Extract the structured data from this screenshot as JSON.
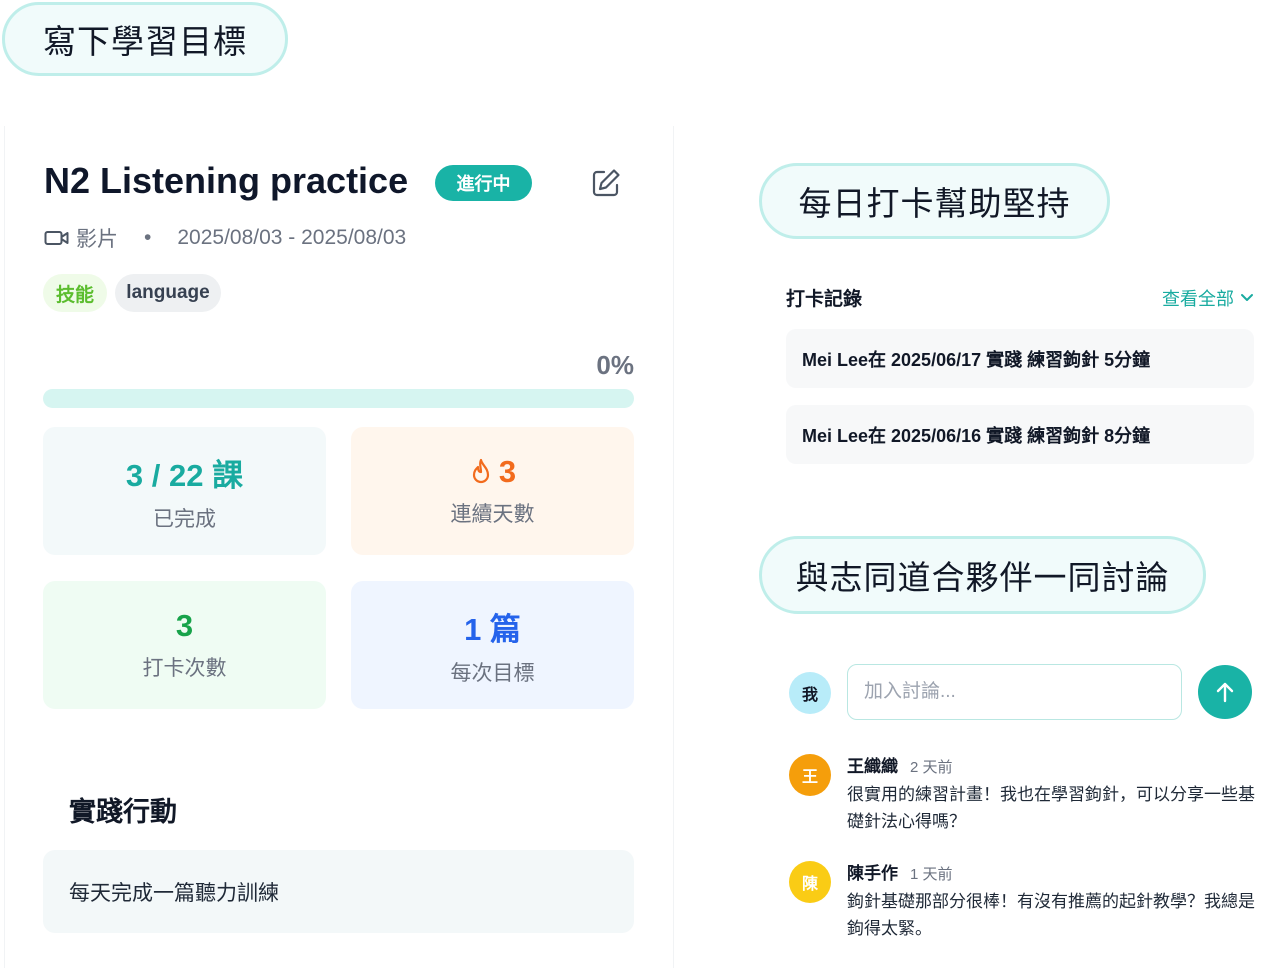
{
  "headers": {
    "pill1": "寫下學習目標",
    "pill2": "每日打卡幫助堅持",
    "pill3": "與志同道合夥伴一同討論"
  },
  "goal": {
    "title": "N2 Listening practice",
    "status": "進行中",
    "type_label": "影片",
    "separator": "•",
    "date_range": "2025/08/03 - 2025/08/03",
    "tags": [
      "技能",
      "language"
    ],
    "progress_label": "0%",
    "progress_fraction": 0.0
  },
  "stats": [
    {
      "value": "3 / 22 課",
      "label": "已完成"
    },
    {
      "value": "3",
      "label": "連續天數",
      "icon": "flame-icon"
    },
    {
      "value": "3",
      "label": "打卡次數"
    },
    {
      "value": "1 篇",
      "label": "每次目標"
    }
  ],
  "actions": {
    "title": "實踐行動",
    "items": [
      "每天完成一篇聽力訓練"
    ]
  },
  "checkins": {
    "title": "打卡記錄",
    "view_all": "查看全部",
    "items": [
      "Mei Lee在 2025/06/17 實踐 練習鉤針 5分鐘",
      "Mei Lee在 2025/06/16 實踐 練習鉤針 8分鐘"
    ]
  },
  "discussion": {
    "me_avatar": "我",
    "input_placeholder": "加入討論...",
    "comments": [
      {
        "avatar": "王",
        "name": "王織織",
        "time": "2 天前",
        "text": "很實用的練習計畫！我也在學習鉤針，可以分享一些基礎針法心得嗎？"
      },
      {
        "avatar": "陳",
        "name": "陳手作",
        "time": "1 天前",
        "text": "鉤針基礎那部分很棒！有沒有推薦的起針教學？我總是鉤得太緊。"
      }
    ]
  },
  "colors": {
    "accent": "#19b3a6",
    "streak": "#f26b1d",
    "checkin": "#17a34a",
    "target": "#2563eb"
  }
}
